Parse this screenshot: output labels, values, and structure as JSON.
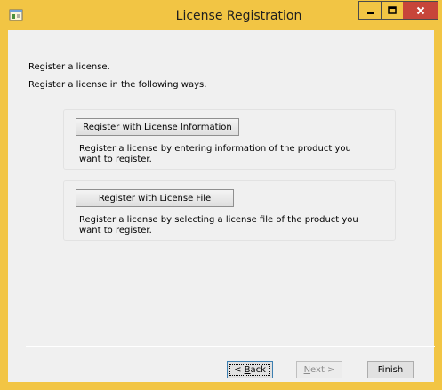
{
  "window": {
    "title": "License Registration",
    "colors": {
      "frame": "#f2c544",
      "close": "#c7453a",
      "client": "#f0f0f0"
    }
  },
  "intro": {
    "line1": "Register a license.",
    "line2": "Register a license in the following ways."
  },
  "options": [
    {
      "button_label": "Register with License Information",
      "description": "Register a license by entering information of the product you want to register."
    },
    {
      "button_label": "Register with License File",
      "description": "Register a license by selecting a license file of the product you want to register."
    }
  ],
  "footer": {
    "back_prefix": "< ",
    "back_mnemonic": "B",
    "back_rest": "ack",
    "next_mnemonic": "N",
    "next_rest": "ext >",
    "finish_label": "Finish"
  }
}
